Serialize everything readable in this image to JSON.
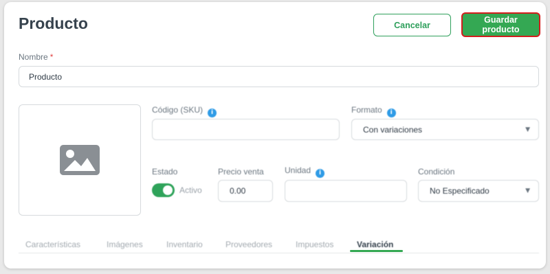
{
  "header": {
    "title": "Producto",
    "cancel_label": "Cancelar",
    "save_label": "Guardar producto"
  },
  "form": {
    "name": {
      "label": "Nombre",
      "required_mark": "*",
      "value": "Producto"
    },
    "sku": {
      "label": "Código (SKU)",
      "value": ""
    },
    "format": {
      "label": "Formato",
      "value": "Con variaciones"
    },
    "status": {
      "label": "Estado",
      "value": "Activo",
      "on": true
    },
    "price": {
      "label": "Precio venta",
      "value": "0.00"
    },
    "unit": {
      "label": "Unidad",
      "value": ""
    },
    "condition": {
      "label": "Condición",
      "value": "No Especificado"
    }
  },
  "tabs": [
    {
      "label": "Características"
    },
    {
      "label": "Imágenes"
    },
    {
      "label": "Inventario"
    },
    {
      "label": "Proveedores"
    },
    {
      "label": "Impuestos"
    },
    {
      "label": "Variación",
      "active": true
    }
  ],
  "icons": {
    "info": "info-icon",
    "image_placeholder": "image-icon",
    "chevron": "chevron-down-icon"
  },
  "colors": {
    "accent": "#34a853",
    "focus_border": "#d31c1c",
    "info": "#2f9be6"
  }
}
